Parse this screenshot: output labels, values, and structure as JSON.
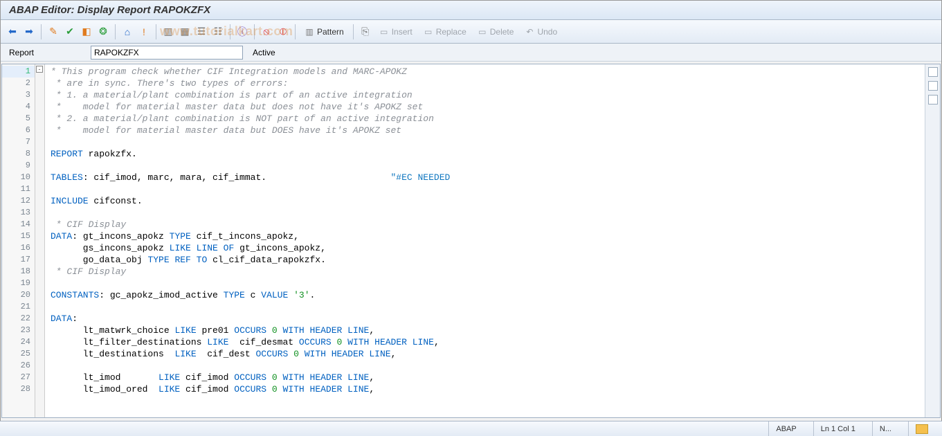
{
  "title": "ABAP Editor: Display Report RAPOKZFX",
  "toolbar": {
    "pattern_label": "Pattern",
    "insert_label": "Insert",
    "replace_label": "Replace",
    "delete_label": "Delete",
    "undo_label": "Undo"
  },
  "report": {
    "label": "Report",
    "name": "RAPOKZFX",
    "status": "Active"
  },
  "watermark": "www.tutorialkart.com",
  "status_bar": {
    "lang": "ABAP",
    "pos": "Ln  1 Col  1",
    "mode": "N..."
  },
  "code_lines": [
    {
      "n": 1,
      "type": "comment",
      "text": "* This program check whether CIF Integration models and MARC-APOKZ"
    },
    {
      "n": 2,
      "type": "comment",
      "text": " * are in sync. There's two types of errors:"
    },
    {
      "n": 3,
      "type": "comment",
      "text": " * 1. a material/plant combination is part of an active integration"
    },
    {
      "n": 4,
      "type": "comment",
      "text": " *    model for material master data but does not have it's APOKZ set"
    },
    {
      "n": 5,
      "type": "comment",
      "text": " * 2. a material/plant combination is NOT part of an active integration"
    },
    {
      "n": 6,
      "type": "comment",
      "text": " *    model for material master data but DOES have it's APOKZ set"
    },
    {
      "n": 7,
      "type": "blank",
      "text": ""
    },
    {
      "n": 8,
      "type": "code",
      "tokens": [
        [
          "kw",
          "REPORT"
        ],
        [
          "",
          ": rapokzfx."
        ]
      ]
    },
    {
      "n": 9,
      "type": "blank",
      "text": ""
    },
    {
      "n": 10,
      "type": "code",
      "tokens": [
        [
          "kw",
          "TABLES"
        ],
        [
          "",
          ": cif_imod, marc, mara, cif_immat.                       "
        ],
        [
          "pragma",
          "\"#EC NEEDED"
        ]
      ]
    },
    {
      "n": 11,
      "type": "blank",
      "text": ""
    },
    {
      "n": 12,
      "type": "code",
      "tokens": [
        [
          "kw",
          "INCLUDE"
        ],
        [
          "",
          " cifconst."
        ]
      ]
    },
    {
      "n": 13,
      "type": "blank",
      "text": ""
    },
    {
      "n": 14,
      "type": "comment",
      "text": " * CIF Display"
    },
    {
      "n": 15,
      "type": "code",
      "tokens": [
        [
          "kw",
          "DATA"
        ],
        [
          "",
          ": gt_incons_apokz "
        ],
        [
          "kw",
          "TYPE"
        ],
        [
          "",
          " cif_t_incons_apokz,"
        ]
      ]
    },
    {
      "n": 16,
      "type": "code",
      "tokens": [
        [
          "",
          "      gs_incons_apokz "
        ],
        [
          "kw",
          "LIKE LINE OF"
        ],
        [
          "",
          " gt_incons_apokz,"
        ]
      ]
    },
    {
      "n": 17,
      "type": "code",
      "tokens": [
        [
          "",
          "      go_data_obj "
        ],
        [
          "kw",
          "TYPE REF TO"
        ],
        [
          "",
          " cl_cif_data_rapokzfx."
        ]
      ]
    },
    {
      "n": 18,
      "type": "comment",
      "text": " * CIF Display"
    },
    {
      "n": 19,
      "type": "blank",
      "text": ""
    },
    {
      "n": 20,
      "type": "code",
      "tokens": [
        [
          "kw",
          "CONSTANTS"
        ],
        [
          "",
          ": gc_apokz_imod_active "
        ],
        [
          "kw",
          "TYPE"
        ],
        [
          "",
          " c "
        ],
        [
          "kw",
          "VALUE"
        ],
        [
          "",
          " "
        ],
        [
          "lit",
          "'3'"
        ],
        [
          "",
          "."
        ]
      ]
    },
    {
      "n": 21,
      "type": "blank",
      "text": ""
    },
    {
      "n": 22,
      "type": "code",
      "tokens": [
        [
          "kw",
          "DATA"
        ],
        [
          "",
          ":"
        ]
      ]
    },
    {
      "n": 23,
      "type": "code",
      "tokens": [
        [
          "",
          "      lt_matwrk_choice "
        ],
        [
          "kw",
          "LIKE"
        ],
        [
          "",
          " pre01 "
        ],
        [
          "kw",
          "OCCURS"
        ],
        [
          "",
          " "
        ],
        [
          "lit",
          "0"
        ],
        [
          "",
          " "
        ],
        [
          "kw",
          "WITH HEADER LINE"
        ],
        [
          "",
          ","
        ]
      ]
    },
    {
      "n": 24,
      "type": "code",
      "tokens": [
        [
          "",
          "      lt_filter_destinations "
        ],
        [
          "kw",
          "LIKE"
        ],
        [
          "",
          "  cif_desmat "
        ],
        [
          "kw",
          "OCCURS"
        ],
        [
          "",
          " "
        ],
        [
          "lit",
          "0"
        ],
        [
          "",
          " "
        ],
        [
          "kw",
          "WITH HEADER LINE"
        ],
        [
          "",
          ","
        ]
      ]
    },
    {
      "n": 25,
      "type": "code",
      "tokens": [
        [
          "",
          "      lt_destinations  "
        ],
        [
          "kw",
          "LIKE"
        ],
        [
          "",
          "  cif_dest "
        ],
        [
          "kw",
          "OCCURS"
        ],
        [
          "",
          " "
        ],
        [
          "lit",
          "0"
        ],
        [
          "",
          " "
        ],
        [
          "kw",
          "WITH HEADER LINE"
        ],
        [
          "",
          ","
        ]
      ]
    },
    {
      "n": 26,
      "type": "blank",
      "text": ""
    },
    {
      "n": 27,
      "type": "code",
      "tokens": [
        [
          "",
          "      lt_imod       "
        ],
        [
          "kw",
          "LIKE"
        ],
        [
          "",
          " cif_imod "
        ],
        [
          "kw",
          "OCCURS"
        ],
        [
          "",
          " "
        ],
        [
          "lit",
          "0"
        ],
        [
          "",
          " "
        ],
        [
          "kw",
          "WITH HEADER LINE"
        ],
        [
          "",
          ","
        ]
      ]
    },
    {
      "n": 28,
      "type": "code",
      "tokens": [
        [
          "",
          "      lt_imod_ored  "
        ],
        [
          "kw",
          "LIKE"
        ],
        [
          "",
          " cif_imod "
        ],
        [
          "kw",
          "OCCURS"
        ],
        [
          "",
          " "
        ],
        [
          "lit",
          "0"
        ],
        [
          "",
          " "
        ],
        [
          "kw",
          "WITH HEADER LINE"
        ],
        [
          "",
          ","
        ]
      ]
    }
  ]
}
